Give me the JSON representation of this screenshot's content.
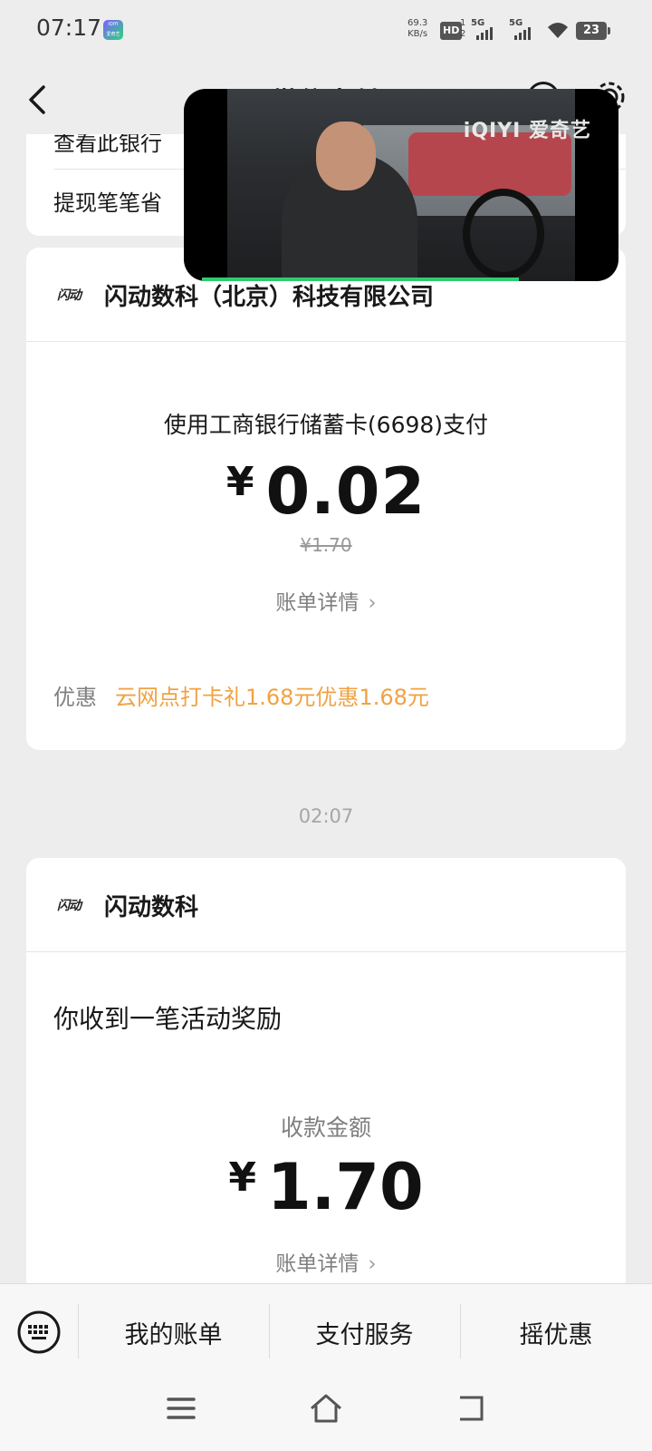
{
  "status_bar": {
    "time": "07:17",
    "app_icon": "iqiyi-app-icon",
    "net_speed_value": "69.3",
    "net_speed_unit": "KB/s",
    "hd": "HD",
    "hd_sub": "1\n2",
    "signal_1": "5G",
    "signal_2": "5G",
    "battery": "23"
  },
  "nav": {
    "title": "微信支付",
    "back_icon": "chevron-left-icon",
    "icons": [
      "profile-icon",
      "settings-icon"
    ]
  },
  "top_card": {
    "row_1": "查看此银行",
    "row_2": "提现笔笔省"
  },
  "payment_card": {
    "merchant_logo": "闪动",
    "merchant_name": "闪动数科（北京）科技有限公司",
    "pay_method": "使用工商银行储蓄卡(6698)支付",
    "currency": "¥",
    "amount": "0.02",
    "original_price": "¥1.70",
    "bill_link": "账单详情",
    "discount_label": "优惠",
    "discount_text": "云网点打卡礼1.68元优惠1.68元"
  },
  "timestamp": "02:07",
  "reward_card": {
    "merchant_logo": "闪动",
    "merchant_name": "闪动数科",
    "title": "你收到一笔活动奖励",
    "received_label": "收款金额",
    "currency": "¥",
    "amount": "1.70",
    "bill_link": "账单详情"
  },
  "pip_video": {
    "watermark": "iQIYI 爱奇艺",
    "progress": 0.73
  },
  "bottom_menu": {
    "items": [
      "我的账单",
      "支付服务",
      "摇优惠"
    ]
  },
  "colors": {
    "background": "#ededed",
    "card": "#ffffff",
    "discount_orange": "#f0a242",
    "progress_green": "#2ecc71"
  }
}
